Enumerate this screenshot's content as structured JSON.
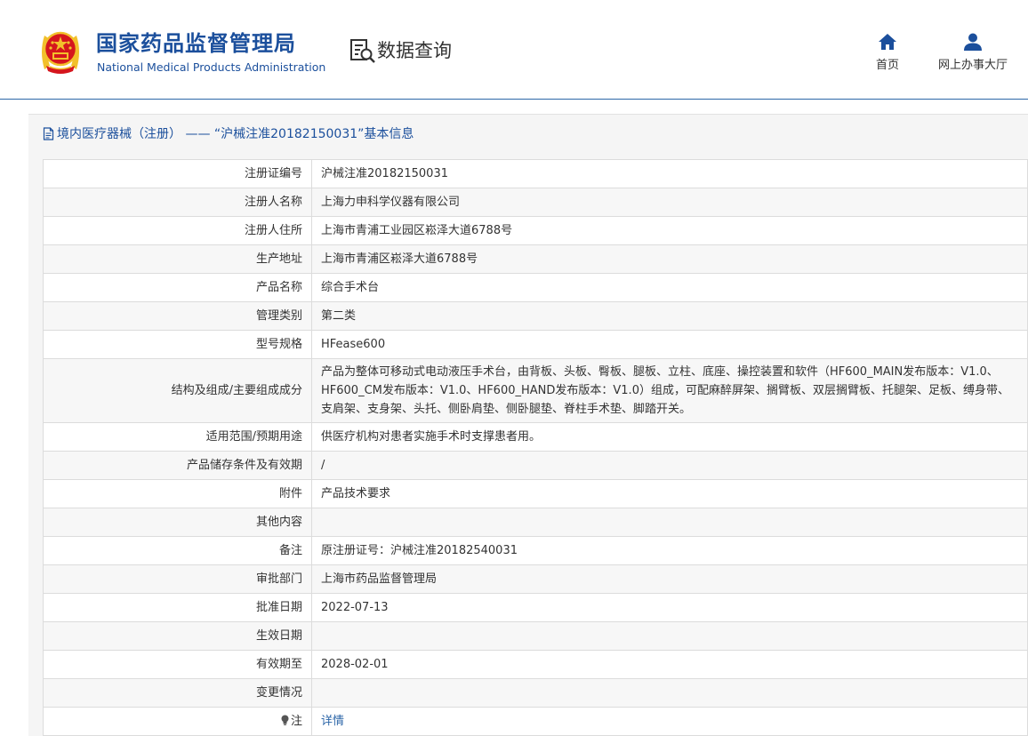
{
  "header": {
    "org_name_cn": "国家药品监督管理局",
    "org_name_en": "National Medical Products Administration",
    "query_title": "数据查询",
    "nav": [
      {
        "label": "首页",
        "icon": "home-icon"
      },
      {
        "label": "网上办事大厅",
        "icon": "user-icon"
      }
    ]
  },
  "panel": {
    "title": "境内医疗器械（注册） —— “沪械注准20182150031”基本信息"
  },
  "rows": [
    {
      "label": "注册证编号",
      "value": "沪械注准20182150031"
    },
    {
      "label": "注册人名称",
      "value": "上海力申科学仪器有限公司"
    },
    {
      "label": "注册人住所",
      "value": "上海市青浦工业园区崧泽大道6788号"
    },
    {
      "label": "生产地址",
      "value": "上海市青浦区崧泽大道6788号"
    },
    {
      "label": "产品名称",
      "value": "综合手术台"
    },
    {
      "label": "管理类别",
      "value": "第二类"
    },
    {
      "label": "型号规格",
      "value": "HFease600"
    },
    {
      "label": "结构及组成/主要组成成分",
      "value": "产品为整体可移动式电动液压手术台，由背板、头板、臀板、腿板、立柱、底座、操控装置和软件（HF600_MAIN发布版本：V1.0、HF600_CM发布版本：V1.0、HF600_HAND发布版本：V1.0）组成，可配麻醉屏架、搁臂板、双层搁臂板、托腿架、足板、缚身带、支肩架、支身架、头托、侧卧肩垫、侧卧腿垫、脊柱手术垫、脚踏开关。"
    },
    {
      "label": "适用范围/预期用途",
      "value": "供医疗机构对患者实施手术时支撑患者用。"
    },
    {
      "label": "产品储存条件及有效期",
      "value": "/"
    },
    {
      "label": "附件",
      "value": "产品技术要求"
    },
    {
      "label": "其他内容",
      "value": ""
    },
    {
      "label": "备注",
      "value": "原注册证号：沪械注准20182540031"
    },
    {
      "label": "审批部门",
      "value": "上海市药品监督管理局"
    },
    {
      "label": "批准日期",
      "value": "2022-07-13"
    },
    {
      "label": "生效日期",
      "value": ""
    },
    {
      "label": "有效期至",
      "value": "2028-02-01"
    },
    {
      "label": "变更情况",
      "value": ""
    }
  ],
  "note_row": {
    "label": "注",
    "link_text": "详情",
    "icon": "lightbulb-icon"
  },
  "colors": {
    "brand_blue": "#1b4f9c",
    "link_blue": "#2c66a8",
    "emblem_red": "#d5161d",
    "emblem_gold": "#f2c02b"
  }
}
